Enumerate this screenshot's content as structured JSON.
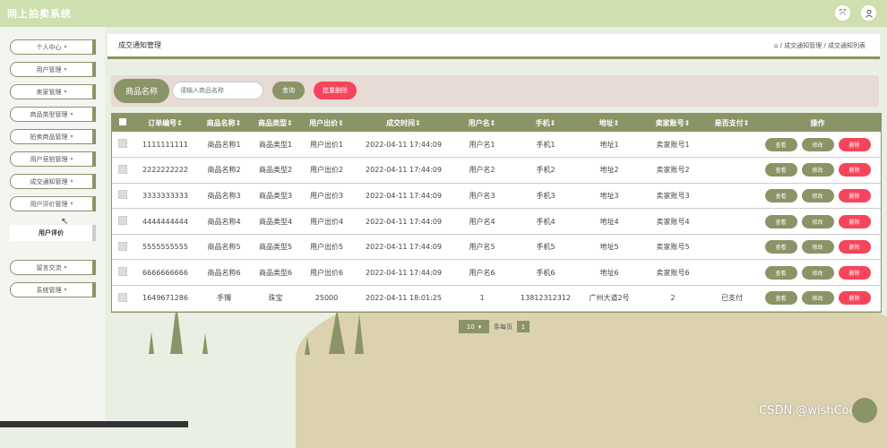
{
  "app": {
    "title": "网上拍卖系统"
  },
  "header": {
    "icons": [
      "fullscreen-icon",
      "user-icon"
    ]
  },
  "sidebar": {
    "items": [
      {
        "label": "个人中心"
      },
      {
        "label": "用户管理"
      },
      {
        "label": "卖家管理"
      },
      {
        "label": "商品类型管理"
      },
      {
        "label": "拍卖商品管理"
      },
      {
        "label": "用户竞拍管理"
      },
      {
        "label": "成交通知管理"
      },
      {
        "label": "用户评价管理"
      },
      {
        "label": "留言交流"
      },
      {
        "label": "系统管理"
      }
    ],
    "sub_item": "用户评价"
  },
  "breadcrumb": {
    "title": "成交通知管理",
    "path": "/ 成交通知管理 / 成交通知列表"
  },
  "search": {
    "label": "商品名称",
    "placeholder": "请输入商品名称",
    "query_button": "查询",
    "batch_delete_button": "批量删除"
  },
  "table": {
    "headers": [
      "订单编号",
      "商品名称",
      "商品类型",
      "用户出价",
      "成交时间",
      "用户名",
      "手机",
      "地址",
      "卖家账号",
      "是否支付",
      "操作"
    ],
    "rows": [
      [
        "1111111111",
        "商品名称1",
        "商品类型1",
        "用户出价1",
        "2022-04-11 17:44:09",
        "用户名1",
        "手机1",
        "地址1",
        "卖家账号1",
        ""
      ],
      [
        "2222222222",
        "商品名称2",
        "商品类型2",
        "用户出价2",
        "2022-04-11 17:44:09",
        "用户名2",
        "手机2",
        "地址2",
        "卖家账号2",
        ""
      ],
      [
        "3333333333",
        "商品名称3",
        "商品类型3",
        "用户出价3",
        "2022-04-11 17:44:09",
        "用户名3",
        "手机3",
        "地址3",
        "卖家账号3",
        ""
      ],
      [
        "4444444444",
        "商品名称4",
        "商品类型4",
        "用户出价4",
        "2022-04-11 17:44:09",
        "用户名4",
        "手机4",
        "地址4",
        "卖家账号4",
        ""
      ],
      [
        "5555555555",
        "商品名称5",
        "商品类型5",
        "用户出价5",
        "2022-04-11 17:44:09",
        "用户名5",
        "手机5",
        "地址5",
        "卖家账号5",
        ""
      ],
      [
        "6666666666",
        "商品名称6",
        "商品类型6",
        "用户出价6",
        "2022-04-11 17:44:09",
        "用户名6",
        "手机6",
        "地址6",
        "卖家账号6",
        ""
      ],
      [
        "1649671286",
        "手镯",
        "珠宝",
        "25000",
        "2022-04-11 18:01:25",
        "1",
        "13812312312",
        "广州大道2号",
        "2",
        "已支付"
      ]
    ],
    "actions": {
      "view": "查看",
      "edit": "修改",
      "delete": "删除"
    }
  },
  "pagination": {
    "page_size": "10",
    "per_page_label": "条每页",
    "current_page": "1"
  },
  "watermark": "CSDN @wishCoding",
  "colors": {
    "accent": "#8a9466",
    "danger": "#f5455c",
    "topbar": "#cfe0b0"
  }
}
